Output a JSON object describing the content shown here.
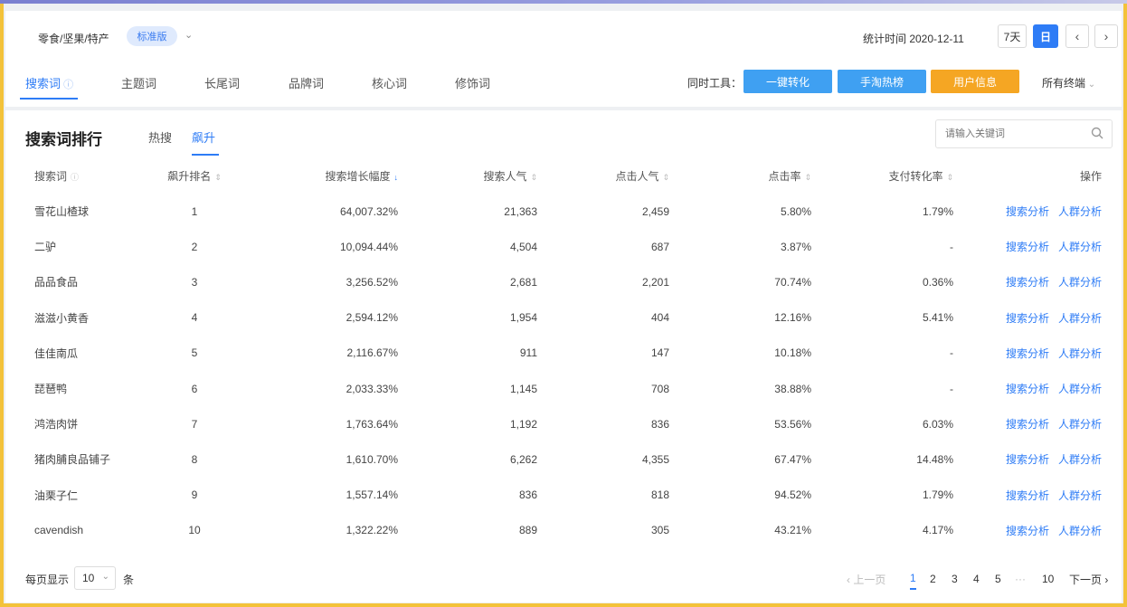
{
  "header": {
    "breadcrumb": "零食/坚果/特产",
    "badge": "标准版",
    "stat_time": "统计时间 2020-12-11",
    "range_7d": "7天",
    "range_day": "日",
    "prev": "‹",
    "next": "›"
  },
  "tabs": [
    {
      "label": "搜索词"
    },
    {
      "label": "主题词"
    },
    {
      "label": "长尾词"
    },
    {
      "label": "品牌词"
    },
    {
      "label": "核心词"
    },
    {
      "label": "修饰词"
    }
  ],
  "toolbar": {
    "label": "同时工具：",
    "btn1": "一键转化",
    "btn2": "手淘热榜",
    "btn3": "用户信息",
    "all_terminals": "所有终端"
  },
  "ranking": {
    "title": "搜索词排行",
    "tab_hot": "热搜",
    "tab_rise": "飙升",
    "search_placeholder": "请输入关键词"
  },
  "table": {
    "headers": [
      "搜索词",
      "飙升排名",
      "搜索增长幅度",
      "搜索人气",
      "点击人气",
      "点击率",
      "支付转化率",
      "操作"
    ],
    "op_search": "搜索分析",
    "op_crowd": "人群分析",
    "rows": [
      [
        "雪花山楂球",
        "1",
        "64,007.32%",
        "21,363",
        "2,459",
        "5.80%",
        "1.79%"
      ],
      [
        "二驴",
        "2",
        "10,094.44%",
        "4,504",
        "687",
        "3.87%",
        "-"
      ],
      [
        "品品食品",
        "3",
        "3,256.52%",
        "2,681",
        "2,201",
        "70.74%",
        "0.36%"
      ],
      [
        "滋滋小黄香",
        "4",
        "2,594.12%",
        "1,954",
        "404",
        "12.16%",
        "5.41%"
      ],
      [
        "佳佳南瓜",
        "5",
        "2,116.67%",
        "911",
        "147",
        "10.18%",
        "-"
      ],
      [
        "琵琶鸭",
        "6",
        "2,033.33%",
        "1,145",
        "708",
        "38.88%",
        "-"
      ],
      [
        "鸿浩肉饼",
        "7",
        "1,763.64%",
        "1,192",
        "836",
        "53.56%",
        "6.03%"
      ],
      [
        "猪肉脯良品铺子",
        "8",
        "1,610.70%",
        "6,262",
        "4,355",
        "67.47%",
        "14.48%"
      ],
      [
        "油栗子仁",
        "9",
        "1,557.14%",
        "836",
        "818",
        "94.52%",
        "1.79%"
      ],
      [
        "cavendish",
        "10",
        "1,322.22%",
        "889",
        "305",
        "43.21%",
        "4.17%"
      ]
    ]
  },
  "pagination": {
    "per_page_label": "每页显示",
    "per_page_value": "10",
    "per_page_unit": "条",
    "prev": "‹ 上一页",
    "pages": [
      "1",
      "2",
      "3",
      "4",
      "5",
      "···",
      "10"
    ],
    "next": "下一页 ›"
  },
  "colors": {
    "accent": "#2e7cf6",
    "btn1": "#2e9bf0",
    "btn2": "#2e9bf0",
    "btn3": "#f5a623"
  }
}
